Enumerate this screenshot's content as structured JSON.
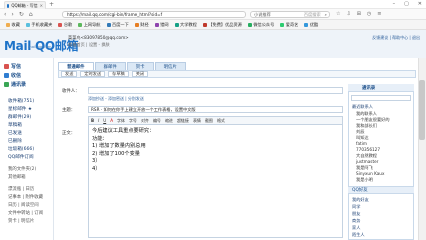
{
  "browser": {
    "tab_title": "QQ邮箱 - 写信",
    "url": "https://mail.qq.com/cgi-bin/frame_html?sid=f",
    "search_placeholder": "百度搜索",
    "search_engine": "小说推荐",
    "bookmarks": [
      "收藏",
      "手机收藏夹",
      "谷歌",
      "上网导航",
      "百度一下",
      "财经",
      "猎网",
      "大学教程",
      "【免费】优品资源",
      "微信公众号",
      "爱奇艺",
      "优酷",
      "腾讯首页",
      "网易邮箱"
    ]
  },
  "mail": {
    "logo": "Mail QQ邮箱",
    "logo_sub": "mail.qq.com",
    "user": "菜菜鸟<83097850@qq.com>",
    "user_sub": "邮箱首页 | 设置 - 换肤",
    "top_links": "反馈建议 | 帮助中心 | 退出",
    "side_buttons": [
      {
        "label": "写信",
        "color": "#d9534f"
      },
      {
        "label": "收信",
        "color": "#2f7dd1"
      },
      {
        "label": "通讯录",
        "color": "#3aa655"
      }
    ],
    "folders": [
      "收件箱(751)",
      "星标邮件 ★",
      "群邮件(29)",
      "草稿箱",
      "已发送",
      "已删除",
      "垃圾箱(666)",
      "QQ邮件订阅"
    ],
    "folder_sub": [
      "我的文件夹(2)",
      "其他邮箱",
      "漂流瓶 | 日历",
      "记事本 | 附件收藏",
      "日历 | 阅读空间",
      "文件中转站 | 订阅",
      "贺卡 | 明信片"
    ],
    "compose_tabs": [
      "普通邮件",
      "群邮件",
      "贺卡",
      "明信片"
    ],
    "toolbar_buttons": [
      "发送",
      "定时发送",
      "存草稿",
      "关闭"
    ],
    "to_label": "收件人：",
    "add_cc": "添加抄送 - 添加密送 | 分别发送",
    "subject_label": "主题：",
    "subject_value": "RSR · 如何在你手上建立开放一个工作表格，设置中文版",
    "body_label": "正文：",
    "editor_tools": [
      "B",
      "I",
      "U",
      "A",
      "字体",
      "字号",
      "对齐",
      "编号",
      "缩进",
      "超链接",
      "表情",
      "截图",
      "格式"
    ],
    "body_lines": [
      "今后建议工具重点要研究：",
      "功能：",
      "1) 增加了数量内别总用",
      "2) 增加了100个变量",
      "3）",
      "4）"
    ],
    "right_panel": {
      "title": "通讯录",
      "groups": [
        "最近联系人"
      ],
      "contacts": [
        "我的联系人",
        "一个朋友很要好的",
        "我和部长们",
        "刘辰",
        "叫知达",
        "fatim",
        "770356127",
        "大自然教程",
        "justmaster",
        "我是阿飞",
        "Sinyxun Kaux",
        "我是小明"
      ],
      "section2_title": "QQ好友",
      "section2_items": [
        "我的好友",
        "同学",
        "朋友",
        "商务",
        "家人",
        "陌生人"
      ]
    }
  },
  "colors": {
    "accent": "#1e73c8",
    "highlight": "#f7ef2b"
  }
}
